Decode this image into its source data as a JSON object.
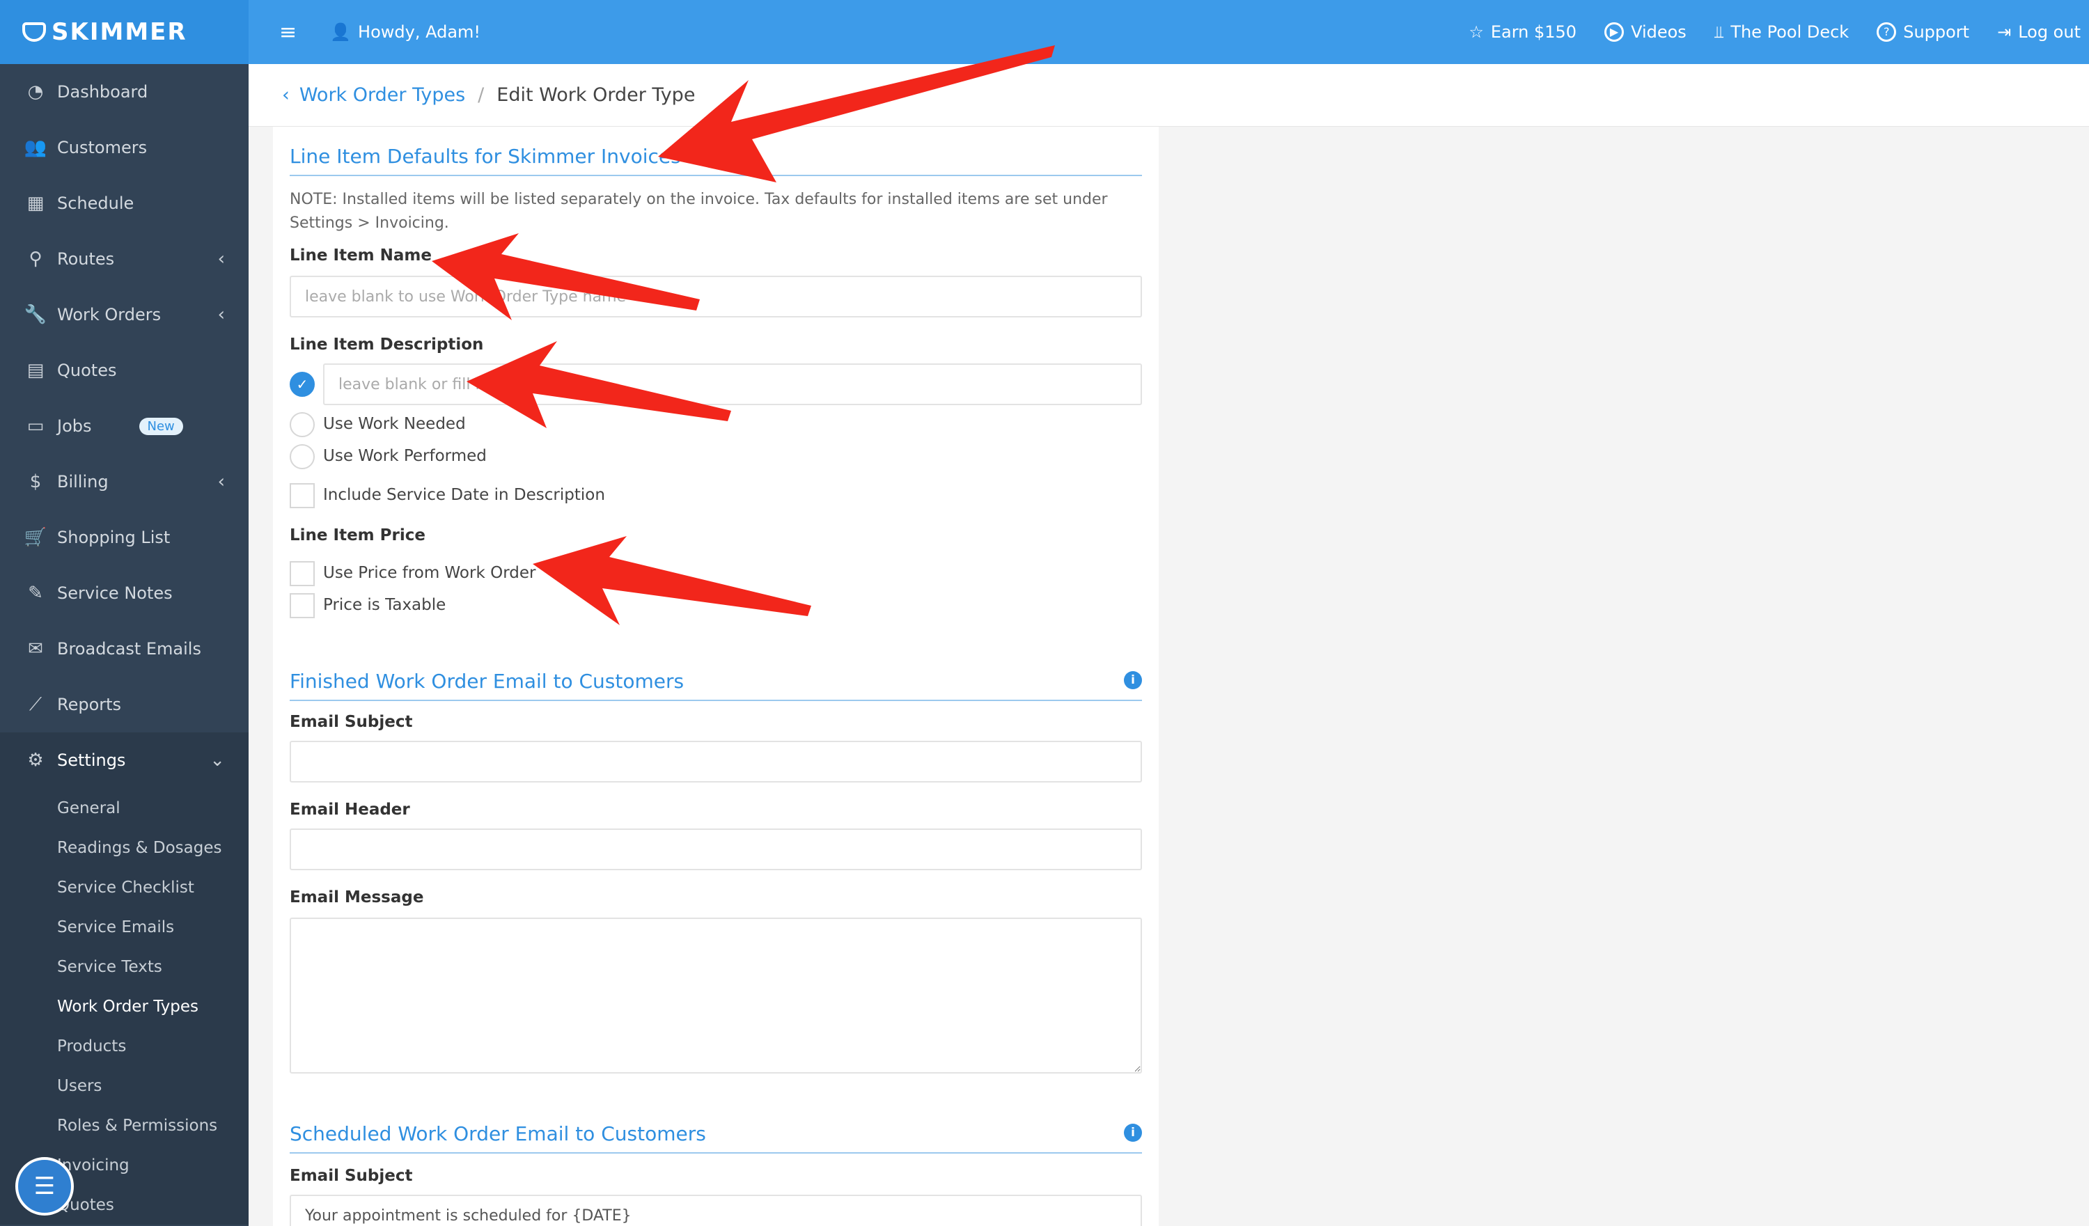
{
  "brand": {
    "name": "SKIMMER"
  },
  "header": {
    "greeting": "Howdy, Adam!",
    "links": [
      {
        "label": "Earn $150",
        "icon": "star-icon"
      },
      {
        "label": "Videos",
        "icon": "play-circle-icon"
      },
      {
        "label": "The Pool Deck",
        "icon": "pool-ladder-icon"
      },
      {
        "label": "Support",
        "icon": "help-circle-icon"
      },
      {
        "label": "Log out",
        "icon": "logout-icon"
      }
    ]
  },
  "sidebar": {
    "items": [
      {
        "label": "Dashboard",
        "icon": "dashboard-icon"
      },
      {
        "label": "Customers",
        "icon": "customers-icon"
      },
      {
        "label": "Schedule",
        "icon": "calendar-icon"
      },
      {
        "label": "Routes",
        "icon": "routes-icon"
      },
      {
        "label": "Work Orders",
        "icon": "wrench-icon"
      },
      {
        "label": "Quotes",
        "icon": "quotes-icon"
      },
      {
        "label": "Jobs",
        "icon": "briefcase-icon",
        "badge": "New"
      },
      {
        "label": "Billing",
        "icon": "billing-icon"
      },
      {
        "label": "Shopping List",
        "icon": "cart-icon"
      },
      {
        "label": "Service Notes",
        "icon": "edit-icon"
      },
      {
        "label": "Broadcast Emails",
        "icon": "mail-icon"
      },
      {
        "label": "Reports",
        "icon": "chart-line-icon"
      }
    ],
    "settings": {
      "label": "Settings",
      "icon": "gear-icon",
      "sub_items": [
        "General",
        "Readings & Dosages",
        "Service Checklist",
        "Service Emails",
        "Service Texts",
        "Work Order Types",
        "Products",
        "Users",
        "Roles & Permissions",
        "Invoicing",
        "Quotes"
      ],
      "active": "Work Order Types"
    }
  },
  "breadcrumb": {
    "parent": "Work Order Types",
    "current": "Edit Work Order Type"
  },
  "form": {
    "line_items": {
      "title": "Line Item Defaults for Skimmer Invoices",
      "note": "NOTE: Installed items will be listed separately on the invoice. Tax defaults for installed items are set under Settings > Invoicing.",
      "name_label": "Line Item Name",
      "name_placeholder": "leave blank to use Work Order Type name",
      "desc_label": "Line Item Description",
      "desc_placeholder": "leave blank or fill in your own",
      "radio_work_needed": "Use Work Needed",
      "radio_work_performed": "Use Work Performed",
      "include_service_date": "Include Service Date in Description",
      "price_label": "Line Item Price",
      "use_price": "Use Price from Work Order",
      "price_taxable": "Price is Taxable"
    },
    "finished_email": {
      "title": "Finished Work Order Email to Customers",
      "subject_label": "Email Subject",
      "header_label": "Email Header",
      "message_label": "Email Message"
    },
    "scheduled_email": {
      "title": "Scheduled Work Order Email to Customers",
      "subject_label": "Email Subject",
      "subject_value": "Your appointment is scheduled for {DATE}"
    }
  },
  "colors": {
    "accent": "#2f8fe0",
    "topbar": "#3d9be9",
    "sidebar": "#324356",
    "arrow": "#f2261b"
  }
}
